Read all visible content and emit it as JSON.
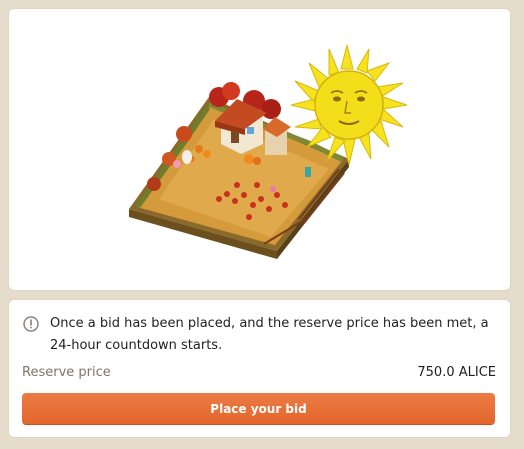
{
  "notice": {
    "icon": "info-circle-icon",
    "text": "Once a bid has been placed, and the reserve price has been met, a 24-hour countdown starts."
  },
  "reserve": {
    "label": "Reserve price",
    "value": "750.0 ALICE"
  },
  "bid_button": {
    "label": "Place your bid"
  },
  "colors": {
    "accent": "#e8692e",
    "background": "#e6dccb",
    "card": "#ffffff",
    "muted_text": "#7d7469"
  }
}
